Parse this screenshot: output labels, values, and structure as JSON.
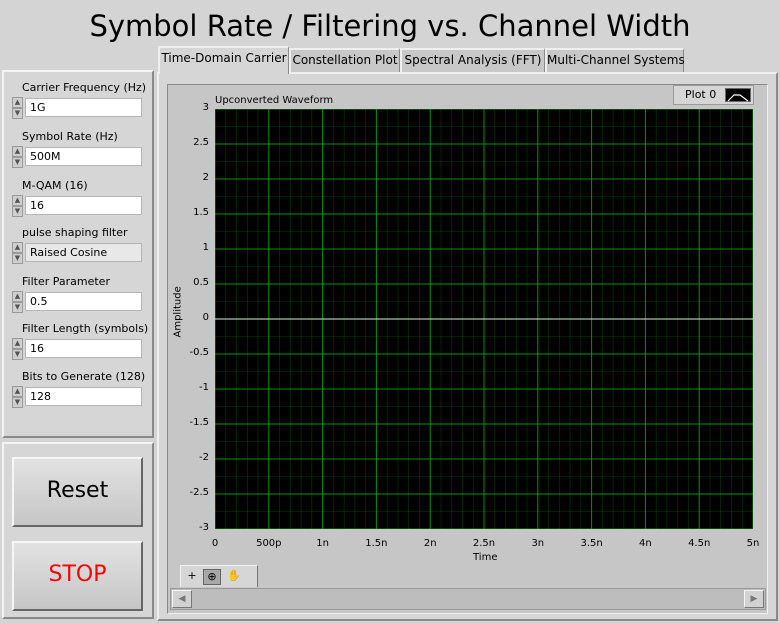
{
  "window": {
    "title": "Symbol Rate / Filtering vs. Channel Width"
  },
  "controls": [
    {
      "label": "Carrier Frequency (Hz)",
      "value": "1G",
      "kind": "numeric"
    },
    {
      "label": "Symbol Rate (Hz)",
      "value": "500M",
      "kind": "numeric"
    },
    {
      "label": "M-QAM (16)",
      "value": "16",
      "kind": "numeric"
    },
    {
      "label": "pulse shaping filter",
      "value": "Raised Cosine",
      "kind": "ring"
    },
    {
      "label": "Filter Parameter",
      "value": "0.5",
      "kind": "numeric"
    },
    {
      "label": "Filter Length (symbols)",
      "value": "16",
      "kind": "numeric"
    },
    {
      "label": "Bits to Generate (128)",
      "value": "128",
      "kind": "numeric"
    }
  ],
  "buttons": {
    "reset_label": "Reset",
    "stop_label": "STOP",
    "stop_color": "#ff0000"
  },
  "tabs": [
    {
      "label": "Time-Domain Carrier",
      "active": true
    },
    {
      "label": "Constellation Plot",
      "active": false
    },
    {
      "label": "Spectral Analysis (FFT)",
      "active": false
    },
    {
      "label": "Multi-Channel Systems",
      "active": false
    }
  ],
  "graph": {
    "plot_name": "Upconverted Waveform",
    "legend_label": "Plot 0",
    "background_color": "#000000",
    "grid_color": "#00a000"
  },
  "icons": {
    "spin_up": "▲",
    "spin_down": "▼",
    "cursor_tool": "+",
    "zoom_tool": "⊕",
    "pan_tool": "✋",
    "scroll_left": "◀",
    "scroll_right": "▶"
  },
  "chart_data": {
    "type": "line",
    "title": "Upconverted Waveform",
    "xlabel": "Time",
    "ylabel": "Amplitude",
    "xlim": [
      0,
      5e-09
    ],
    "ylim": [
      -3,
      3
    ],
    "x_tick_labels": [
      "0",
      "500p",
      "1n",
      "1.5n",
      "2n",
      "2.5n",
      "3n",
      "3.5n",
      "4n",
      "4.5n",
      "5n"
    ],
    "y_tick_labels": [
      "3",
      "2.5",
      "2",
      "1.5",
      "1",
      "0.5",
      "0",
      "-0.5",
      "-1",
      "-1.5",
      "-2",
      "-2.5",
      "-3"
    ],
    "grid": true,
    "legend": "top-right",
    "series": [
      {
        "name": "Plot 0",
        "x": [
          0,
          5e-09
        ],
        "y": [
          0,
          0
        ]
      }
    ]
  }
}
